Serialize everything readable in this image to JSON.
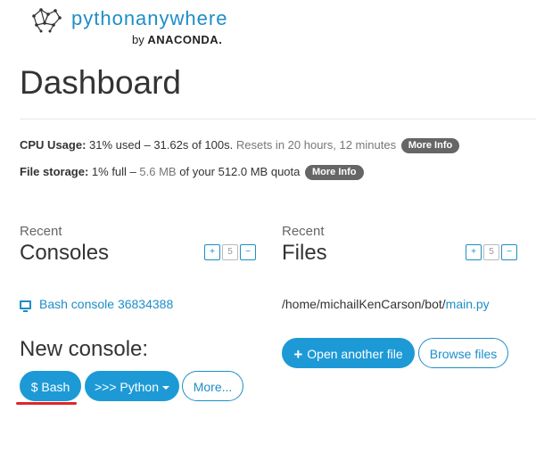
{
  "header": {
    "logo_text": "pythonanywhere",
    "logo_by": "by",
    "logo_brand": "ANACONDA."
  },
  "page_title": "Dashboard",
  "usage": {
    "cpu_label": "CPU Usage:",
    "cpu_used": "31% used – 31.62s of 100s.",
    "cpu_reset": "Resets in 20 hours, 12 minutes",
    "cpu_more": "More Info",
    "cpu_used_fraction": 0.31,
    "storage_label": "File storage:",
    "storage_pct": "1% full –",
    "storage_used": "5.6 MB",
    "storage_quota": "of your 512.0 MB quota",
    "storage_more": "More Info"
  },
  "consoles": {
    "recent_label": "Recent",
    "title": "Consoles",
    "pager": {
      "prev": "+",
      "count": "5",
      "next": "−"
    },
    "items": [
      {
        "label": "Bash console 36834388"
      }
    ],
    "new_console_title": "New console:",
    "buttons": {
      "bash": "$ Bash",
      "python": ">>> Python",
      "more": "More..."
    }
  },
  "files": {
    "recent_label": "Recent",
    "title": "Files",
    "pager": {
      "prev": "+",
      "count": "5",
      "next": "−"
    },
    "items": [
      {
        "path_prefix": "/home/michailKenCarson/bot/",
        "filename": "main.py"
      }
    ],
    "buttons": {
      "open_another": "Open another file",
      "browse": "Browse files"
    }
  },
  "colors": {
    "accent": "#1d9ad6",
    "highlight": "#e0262b"
  }
}
